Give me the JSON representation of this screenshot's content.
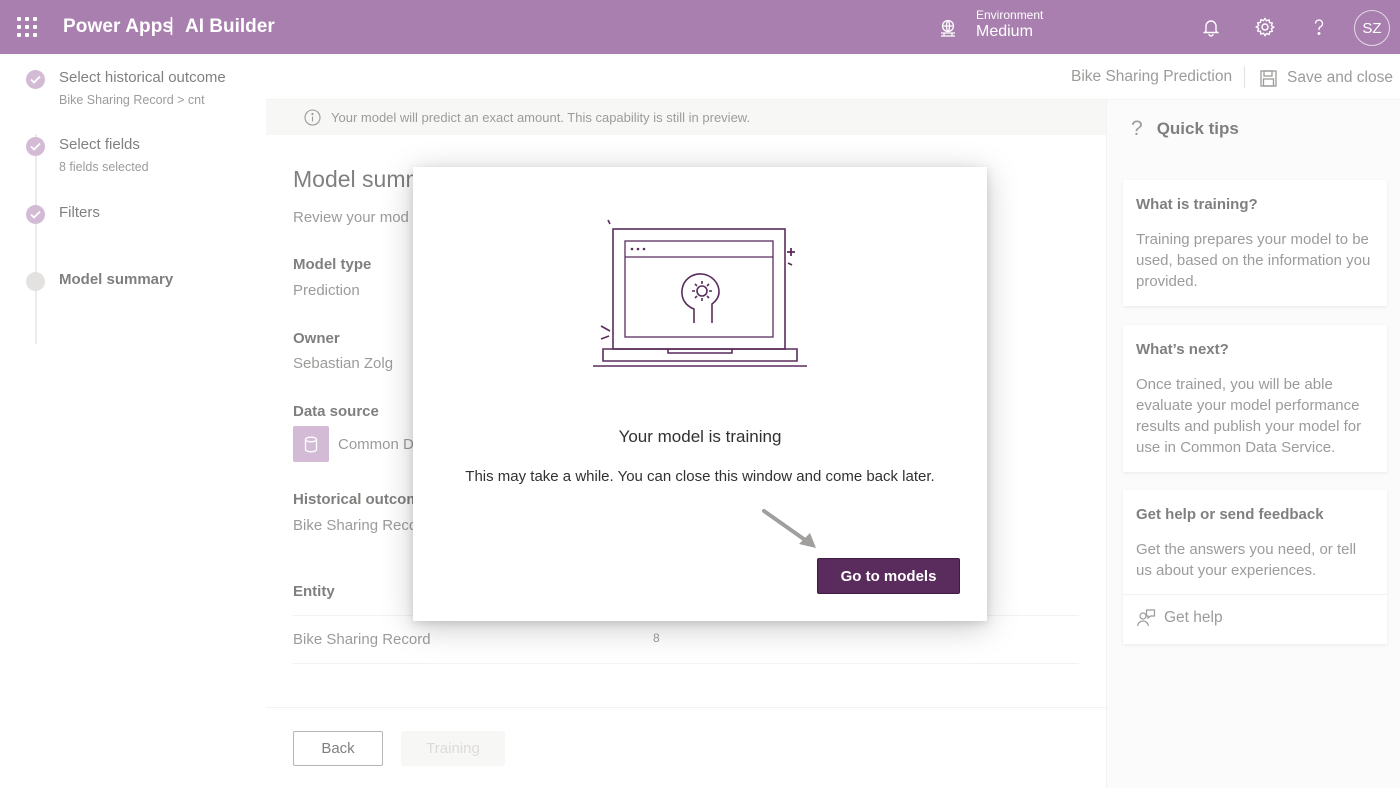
{
  "header": {
    "app_name": "Power Apps",
    "separator": "|",
    "sub_app": "AI Builder",
    "environment_label": "Environment",
    "environment_value": "Medium",
    "avatar_initials": "SZ",
    "bar_color": "#a87fae"
  },
  "stepper": {
    "steps": [
      {
        "title": "Select historical outcome",
        "subtitle": "Bike Sharing Record > cnt",
        "state": "done"
      },
      {
        "title": "Select fields",
        "subtitle": "8 fields selected",
        "state": "done"
      },
      {
        "title": "Filters",
        "subtitle": "",
        "state": "done"
      },
      {
        "title": "Model summary",
        "subtitle": "",
        "state": "current"
      }
    ]
  },
  "command_bar": {
    "model_name": "Bike Sharing Prediction",
    "save_close_label": "Save and close"
  },
  "main": {
    "info_message": "Your model will predict an exact amount. This capability is still in preview.",
    "section_title": "Model summ",
    "section_subtitle": "Review your mod",
    "model_type_label": "Model type",
    "model_type_value": "Prediction",
    "owner_label": "Owner",
    "owner_value": "Sebastian Zolg",
    "data_source_label": "Data source",
    "data_source_value": "Common D",
    "historical_label": "Historical outcom",
    "historical_value": "Bike Sharing Reco",
    "entity_header": "Entity",
    "entity_row": {
      "name": "Bike Sharing Record",
      "count": "8"
    },
    "back_label": "Back",
    "training_label": "Training"
  },
  "tips": {
    "title": "Quick tips",
    "cards": [
      {
        "heading": "What is training?",
        "body": "Training prepares your model to be used, based on the information you provided."
      },
      {
        "heading": "What’s next?",
        "body": "Once trained, you will be able evaluate your model performance results and publish your model for use in Common Data Service."
      },
      {
        "heading": "Get help or send feedback",
        "body": "Get the answers you need, or tell us about your experiences.",
        "link": "Get help"
      }
    ]
  },
  "dialog": {
    "title": "Your model is training",
    "message": "This may take a while. You can close this window and come back later.",
    "button_label": "Go to models",
    "button_color": "#5a2c5d"
  }
}
